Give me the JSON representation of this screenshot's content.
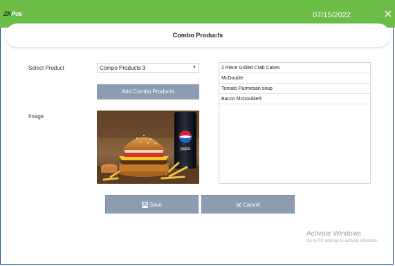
{
  "app": {
    "logo_zk": "ZK",
    "logo_pos": "Pos",
    "date": "07/15/2022"
  },
  "header": {
    "title": "Combo Products"
  },
  "form": {
    "select_product_label": "Select Product",
    "selected_product": "Compo Products 3",
    "add_button": "Add Combo Products",
    "image_label": "Image"
  },
  "combo_items": [
    "2 Piece Grilled Crab Cakes",
    "McDouble",
    "Tomato Parmesan soup",
    "Bacon McDouble®"
  ],
  "image_branding": {
    "can_text": "pepsi"
  },
  "actions": {
    "save": "Save",
    "cancel": "Cancel"
  },
  "watermark": {
    "line1": "Activate Windows",
    "line2": "Go to PC settings to activate Windows."
  },
  "colors": {
    "topbar": "#6cbd46",
    "button": "#8c9db1",
    "frame_border": "#1e4fa0"
  }
}
